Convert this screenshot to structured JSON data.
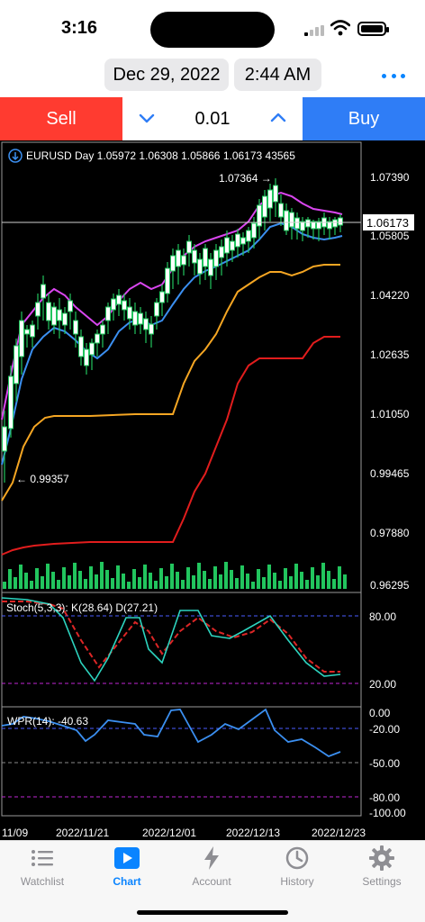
{
  "status": {
    "time": "3:16"
  },
  "header": {
    "date": "Dec 29, 2022",
    "time": "2:44 AM"
  },
  "trade": {
    "sell_label": "Sell",
    "buy_label": "Buy",
    "lot": "0.01"
  },
  "chart": {
    "info": "EURUSD  Day  1.05972  1.06308  1.05866  1.06173  43565",
    "high_label": "1.07364 →",
    "low_label": "← 0.99357",
    "current_price": "1.06173",
    "price_ticks": [
      "1.07390",
      "1.05805",
      "1.04220",
      "1.02635",
      "1.01050",
      "0.99465",
      "0.97880",
      "0.96295"
    ],
    "stoch_label": "Stoch(5,3,3): K(28.64) D(27.21)",
    "stoch_ticks": [
      "80.00",
      "20.00"
    ],
    "wpr_label": "WPR(14): -40.63",
    "wpr_ticks": [
      "0.00",
      "-20.00",
      "-50.00",
      "-80.00",
      "-100.00"
    ],
    "date_ticks": [
      "11/09",
      "2022/11/21",
      "2022/12/01",
      "2022/12/13",
      "2022/12/23"
    ],
    "colors": {
      "bull": "#22c55e",
      "up_line": "#d946ef",
      "down_line": "#3b82f6",
      "orange": "#f5a623",
      "red": "#e11d1d",
      "stoch_d": "#dc2626",
      "stoch_k": "#2dd4bf"
    }
  },
  "tabs": [
    {
      "label": "Watchlist",
      "icon": "list-icon"
    },
    {
      "label": "Chart",
      "icon": "chart-play-icon"
    },
    {
      "label": "Account",
      "icon": "bolt-icon"
    },
    {
      "label": "History",
      "icon": "history-icon"
    },
    {
      "label": "Settings",
      "icon": "gear-icon"
    }
  ]
}
